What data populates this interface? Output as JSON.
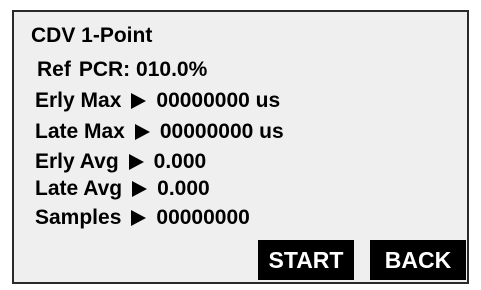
{
  "screen": {
    "title": "CDV 1-Point",
    "ref": {
      "label": "Ref",
      "pcr_label": "PCR:",
      "pcr_value": "010.0%"
    },
    "measurements": [
      {
        "label": "Erly Max",
        "value": "00000000 us"
      },
      {
        "label": "Late Max",
        "value": "00000000 us"
      },
      {
        "label": "Erly Avg",
        "value": "0.000"
      },
      {
        "label": "Late Avg",
        "value": "0.000"
      },
      {
        "label": "Samples",
        "value": "00000000"
      }
    ],
    "buttons": {
      "start_label": "START",
      "back_label": "BACK"
    }
  },
  "colors": {
    "screen_background": "#efefef",
    "button_background": "#000000",
    "button_text": "#ffffff",
    "text": "#000000"
  }
}
